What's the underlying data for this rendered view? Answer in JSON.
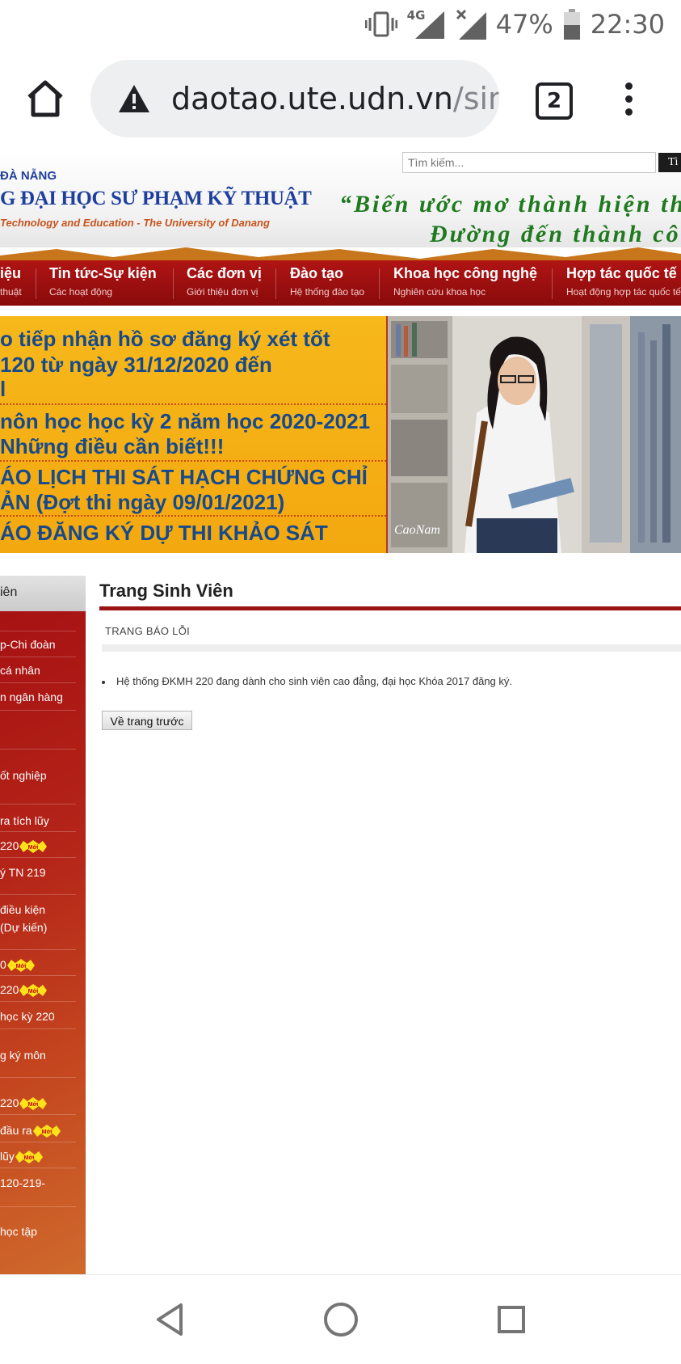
{
  "status_bar": {
    "network": "4G",
    "battery": "47%",
    "time": "22:30",
    "icons": [
      "vibrate-icon",
      "signal-icon",
      "signal-no-data-icon",
      "battery-icon"
    ]
  },
  "browser": {
    "url_host": "daotao.ute.udn.vn",
    "url_path": "/sinh",
    "tab_count": "2",
    "icons": [
      "home-icon",
      "not-secure-warning-icon",
      "tab-switcher-icon",
      "overflow-menu-icon"
    ]
  },
  "header": {
    "uni_super": "ĐÀ NẴNG",
    "uni_name": "G ĐẠI HỌC SƯ PHẠM KỸ THUẬT",
    "uni_english": "Technology and Education - The University of Danang",
    "search_placeholder": "Tìm kiếm...",
    "search_button": "Tì",
    "slogan_line1": "“Biến ước mơ thành hiện thự",
    "slogan_line2": "Đường đến thành côn"
  },
  "nav": {
    "items": [
      {
        "title": "iệu",
        "sub": "thuật"
      },
      {
        "title": "Tin tức-Sự kiện",
        "sub": "Các hoạt động"
      },
      {
        "title": "Các đơn vị",
        "sub": "Giới thiệu đơn vị"
      },
      {
        "title": "Đào tạo",
        "sub": "Hệ thống đào tạo"
      },
      {
        "title": "Khoa học công nghệ",
        "sub": "Nghiên cứu khoa học"
      },
      {
        "title": "Hợp tác quốc tế",
        "sub": "Hoạt động hợp tác quốc tế"
      }
    ]
  },
  "banner": {
    "news_lines": [
      "o tiếp nhận hồ sơ đăng ký xét tốt",
      "120 từ ngày 31/12/2020 đến",
      "l",
      "nôn học học kỳ 2 năm học 2020-2021",
      "Những điều cần biết!!!",
      "ÁO LỊCH THI SÁT HẠCH CHỨNG CHỈ",
      "ẢN (Đợt thi ngày 09/01/2021)",
      "ÁO ĐĂNG KÝ DỰ THI KHẢO SÁT"
    ],
    "photo_signature": "CaoNam"
  },
  "sidebar": {
    "heading": "iên",
    "new_badge": "Mới",
    "items": [
      {
        "label": "p-Chi đoàn"
      },
      {
        "label": "cá nhân"
      },
      {
        "label": "n ngân hàng"
      },
      {
        "label": "ốt nghiệp"
      },
      {
        "label": "ra tích lũy"
      },
      {
        "label": "220"
      },
      {
        "label": "ý TN 219"
      },
      {
        "label": "điều kiện"
      },
      {
        "label": "(Dự kiến)"
      },
      {
        "label": "0"
      },
      {
        "label": "220"
      },
      {
        "label": "học kỳ 220"
      },
      {
        "label": "g ký môn"
      },
      {
        "label": "220"
      },
      {
        "label": "đầu ra"
      },
      {
        "label": "lũy"
      },
      {
        "label": "120-219-"
      },
      {
        "label": "học tập"
      }
    ]
  },
  "main": {
    "title": "Trang Sinh Viên",
    "report_label": "TRANG BÁO LỖI",
    "message": "Hệ thống ĐKMH 220 đang dành cho sinh viên cao đẳng, đại học Khóa 2017 đăng ký.",
    "back_button": "Về trang trước"
  },
  "system_nav": {
    "icons": [
      "back-triangle-icon",
      "home-circle-icon",
      "recents-square-icon"
    ]
  }
}
